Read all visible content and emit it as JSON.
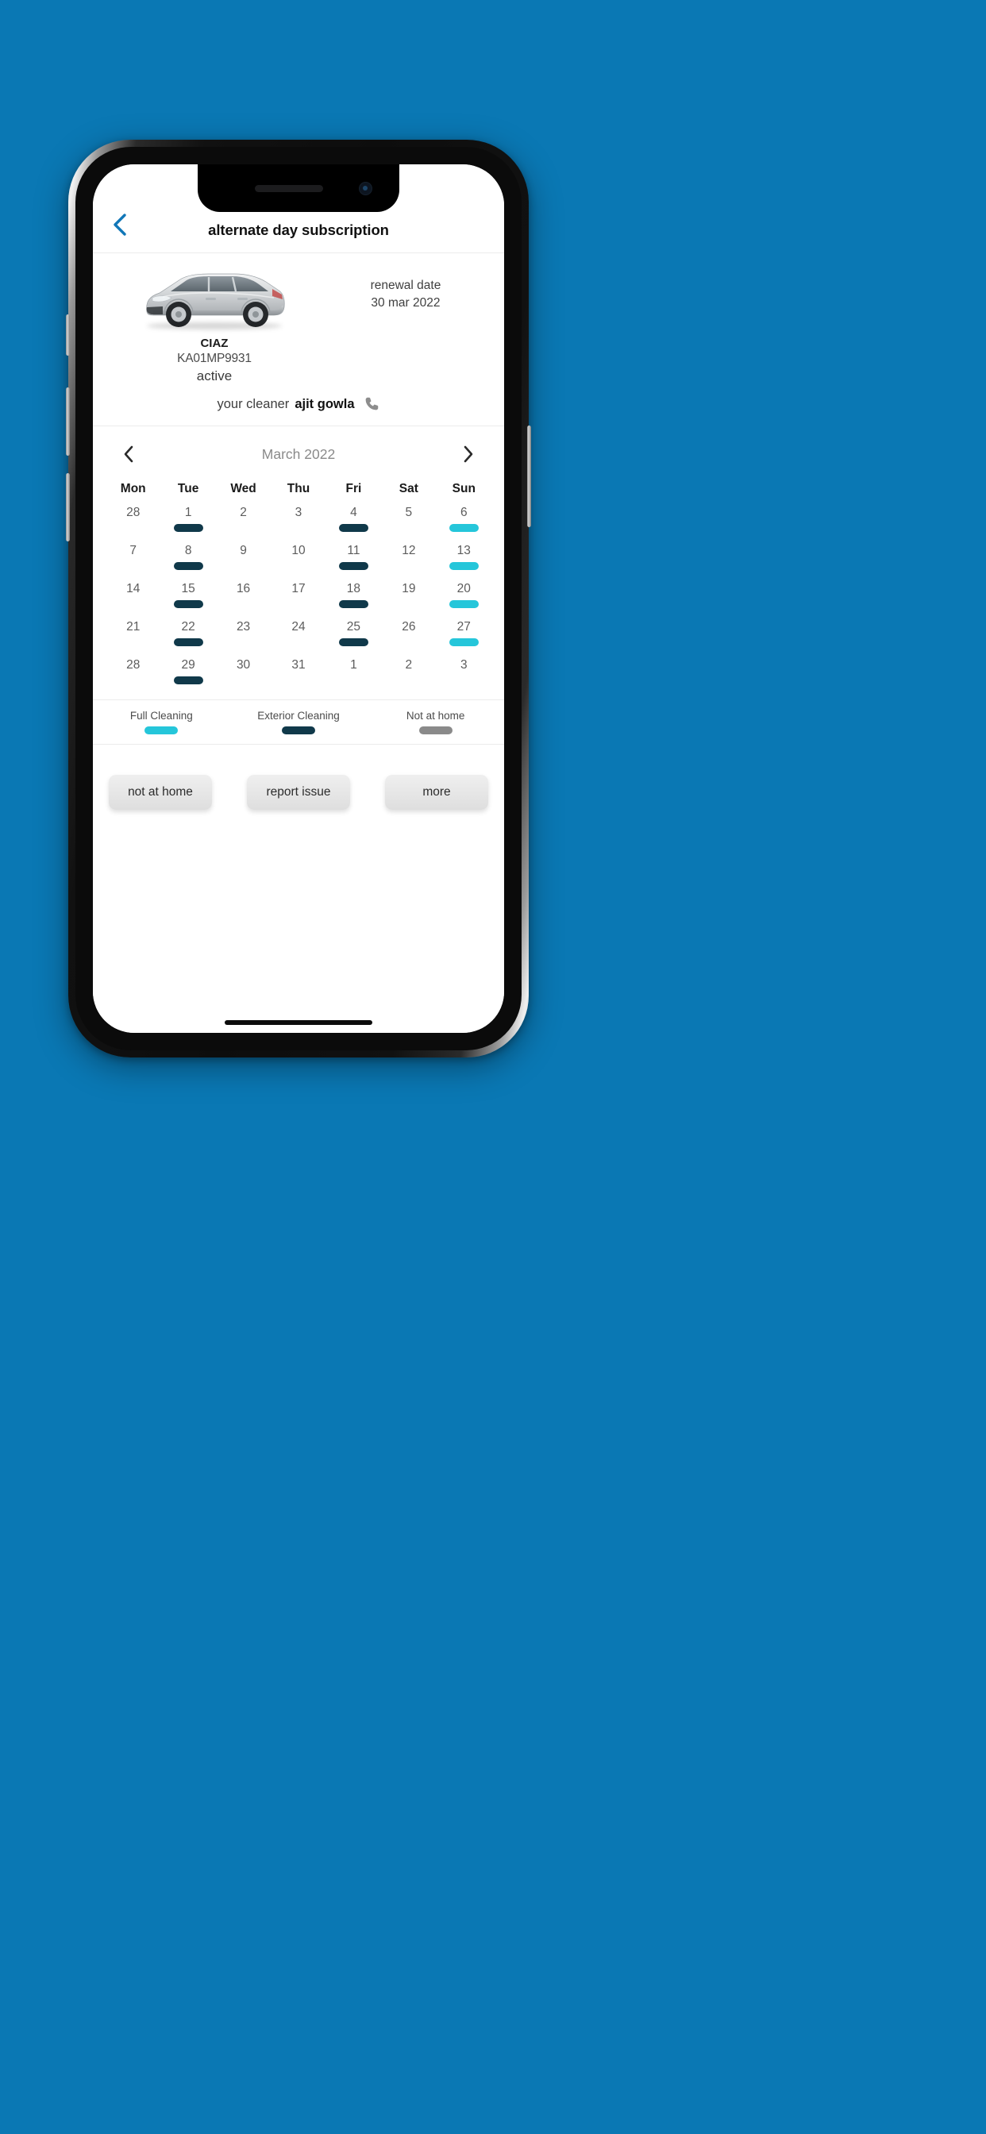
{
  "theme": {
    "background": "#0a78b4",
    "accent_blue": "#1177b8",
    "full_cleaning": "#25c6da",
    "exterior_cleaning": "#10394a",
    "not_at_home": "#8a8a8a"
  },
  "header": {
    "title": "alternate day subscription",
    "back_icon": "chevron-left-icon"
  },
  "vehicle": {
    "image_icon": "car-image",
    "name": "CIAZ",
    "plate": "KA01MP9931",
    "status": "active",
    "renewal_label": "renewal date",
    "renewal_date": "30 mar 2022"
  },
  "cleaner": {
    "label": "your cleaner",
    "name": "ajit gowla",
    "call_icon": "phone-icon"
  },
  "calendar": {
    "prev_icon": "chevron-left-icon",
    "next_icon": "chevron-right-icon",
    "month_label": "March 2022",
    "weekdays": [
      "Mon",
      "Tue",
      "Wed",
      "Thu",
      "Fri",
      "Sat",
      "Sun"
    ],
    "weeks": [
      [
        {
          "day": "28",
          "marker": "none"
        },
        {
          "day": "1",
          "marker": "exterior"
        },
        {
          "day": "2",
          "marker": "none"
        },
        {
          "day": "3",
          "marker": "none"
        },
        {
          "day": "4",
          "marker": "exterior"
        },
        {
          "day": "5",
          "marker": "none"
        },
        {
          "day": "6",
          "marker": "full"
        }
      ],
      [
        {
          "day": "7",
          "marker": "none"
        },
        {
          "day": "8",
          "marker": "exterior"
        },
        {
          "day": "9",
          "marker": "none"
        },
        {
          "day": "10",
          "marker": "none"
        },
        {
          "day": "11",
          "marker": "exterior"
        },
        {
          "day": "12",
          "marker": "none"
        },
        {
          "day": "13",
          "marker": "full"
        }
      ],
      [
        {
          "day": "14",
          "marker": "none"
        },
        {
          "day": "15",
          "marker": "exterior"
        },
        {
          "day": "16",
          "marker": "none"
        },
        {
          "day": "17",
          "marker": "none"
        },
        {
          "day": "18",
          "marker": "exterior"
        },
        {
          "day": "19",
          "marker": "none"
        },
        {
          "day": "20",
          "marker": "full"
        }
      ],
      [
        {
          "day": "21",
          "marker": "none"
        },
        {
          "day": "22",
          "marker": "exterior"
        },
        {
          "day": "23",
          "marker": "none"
        },
        {
          "day": "24",
          "marker": "none"
        },
        {
          "day": "25",
          "marker": "exterior"
        },
        {
          "day": "26",
          "marker": "none"
        },
        {
          "day": "27",
          "marker": "full"
        }
      ],
      [
        {
          "day": "28",
          "marker": "none"
        },
        {
          "day": "29",
          "marker": "exterior"
        },
        {
          "day": "30",
          "marker": "none"
        },
        {
          "day": "31",
          "marker": "none"
        },
        {
          "day": "1",
          "marker": "none"
        },
        {
          "day": "2",
          "marker": "none"
        },
        {
          "day": "3",
          "marker": "none"
        }
      ]
    ]
  },
  "legend": [
    {
      "label": "Full Cleaning",
      "color": "#25c6da"
    },
    {
      "label": "Exterior Cleaning",
      "color": "#10394a"
    },
    {
      "label": "Not at home",
      "color": "#8a8a8a"
    }
  ],
  "actions": [
    {
      "label": "not at home"
    },
    {
      "label": "report issue"
    },
    {
      "label": "more"
    }
  ]
}
